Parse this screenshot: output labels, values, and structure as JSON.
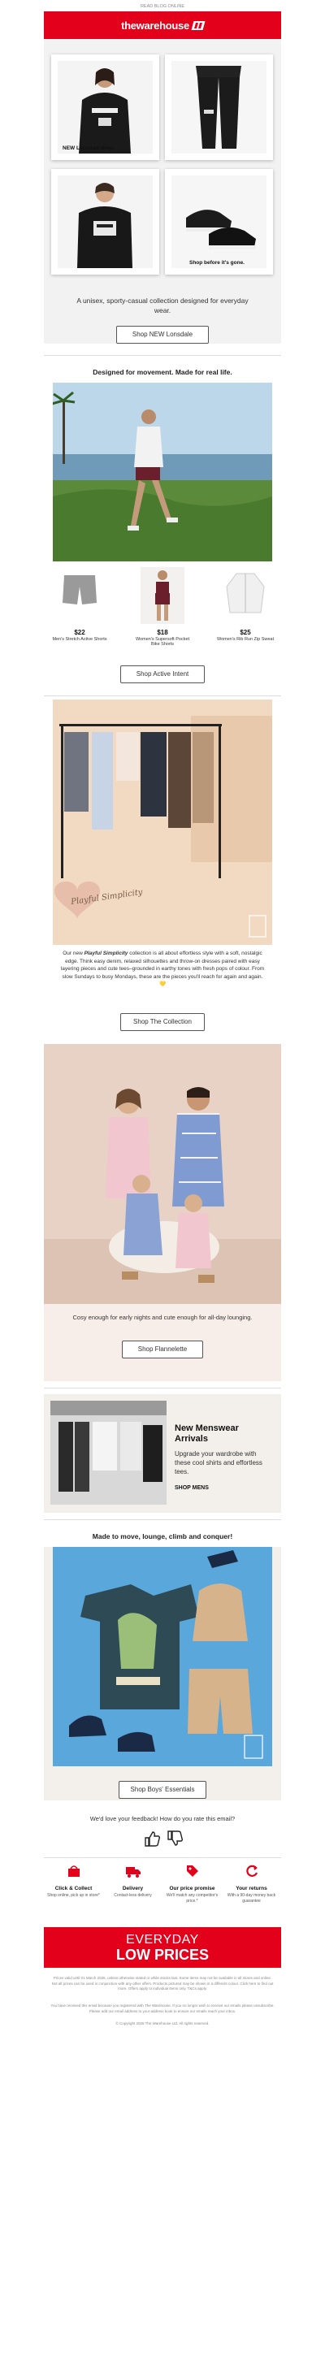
{
  "preheader": "READ BLOG ONLINE",
  "brand": {
    "logo_text": "thewarehouse",
    "red": "#e3001b"
  },
  "hero": {
    "caption_left": "NEW Lonsdale drop.",
    "caption_right": "Shop before it's gone.",
    "tagline": "A unisex, sporty-casual collection designed for everyday wear.",
    "cta": "Shop NEW Lonsdale"
  },
  "active": {
    "heading": "Designed for movement. Made for real life.",
    "products": [
      {
        "price": "$22",
        "name": "Men's Stretch Active Shorts"
      },
      {
        "price": "$18",
        "name": "Women's Supersoft Pocket Bike Shorts"
      },
      {
        "price": "$25",
        "name": "Women's Rib Run Zip Sweat"
      }
    ],
    "cta": "Shop Active Intent"
  },
  "playful": {
    "script_title": "Playful Simplicity",
    "body_prefix": "Our new ",
    "body_em": "Playful Simplicity",
    "body_rest": " collection is all about effortless style with a soft, nostalgic edge. Think easy denim, relaxed silhouettes and throw-on dresses paired with easy layering pieces and cute tees–grounded in earthy tones with fresh pops of colour. From slow Sundays to busy Mondays, these are the pieces you'll reach for again and again. 💛",
    "cta": "Shop The Collection"
  },
  "flannel": {
    "tagline": "Cosy enough for early nights and cute enough for all-day lounging.",
    "cta": "Shop Flannelette"
  },
  "menswear": {
    "title": "New Menswear Arrivals",
    "body": "Upgrade your wardrobe with these cool shirts and effortless tees.",
    "link": "SHOP MENS"
  },
  "boys": {
    "heading": "Made to move, lounge, climb and conquer!",
    "cta": "Shop Boys' Essentials"
  },
  "feedback": {
    "question": "We'd love your feedback! How do you rate this email?"
  },
  "features": [
    {
      "icon": "click-collect-icon",
      "title": "Click & Collect",
      "sub": "Shop online, pick up in store*"
    },
    {
      "icon": "delivery-truck-icon",
      "title": "Delivery",
      "sub": "Contact-less delivery"
    },
    {
      "icon": "price-tag-icon",
      "title": "Our price promise",
      "sub": "We'll match any competitor's price.*"
    },
    {
      "icon": "returns-icon",
      "title": "Your returns",
      "sub": "With a 90-day money back guarantee"
    }
  ],
  "banner": {
    "line1": "EVERYDAY",
    "line2": "LOW PRICES"
  },
  "footer": {
    "p1": "Prices valid until 01 March 2026, unless otherwise stated or while stocks last. Some items may not be available in all stores and online. Not all prices can be used in conjunction with any other offers. Products pictured may be shown in a different colour. Click here to find out more. Offers apply to individual items only. T&Cs apply.",
    "p2": "You have received this email because you registered with The Warehouse. If you no longer wish to receive our emails please unsubscribe. Please add our email address to your address book to ensure our emails reach your inbox.",
    "p3": "© Copyright 2026 The Warehouse Ltd. All rights reserved."
  }
}
